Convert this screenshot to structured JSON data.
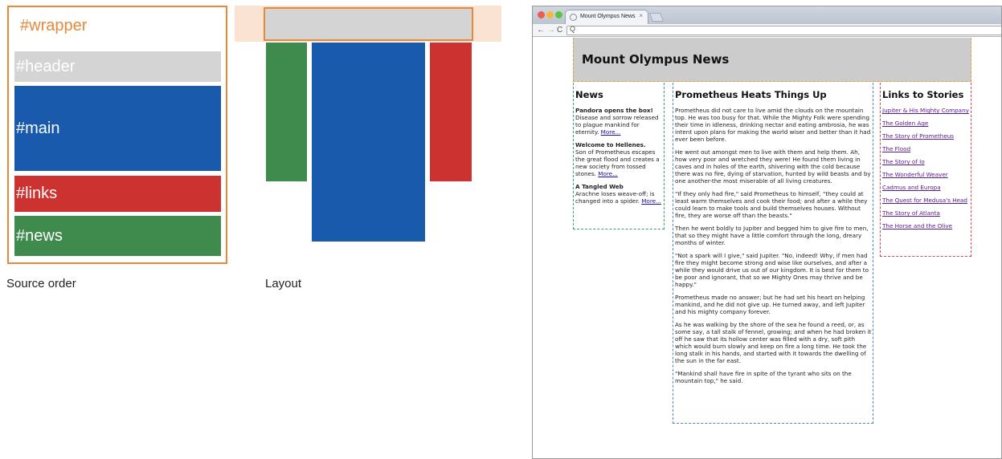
{
  "source_diagram": {
    "wrapper_label": "#wrapper",
    "boxes": [
      {
        "label": "#header",
        "color": "#d4d4d4"
      },
      {
        "label": "#main",
        "color": "#1a5aad"
      },
      {
        "label": "#links",
        "color": "#cc3330"
      },
      {
        "label": "#news",
        "color": "#3f8a4d"
      }
    ],
    "caption": "Source order",
    "accent": "#e8883a"
  },
  "layout_diagram": {
    "caption": "Layout"
  },
  "browser": {
    "tab_title": "Mount Olympus News",
    "tab_close": "×",
    "nav": {
      "back": "←",
      "forward": "→",
      "reload": "C",
      "search": "Q"
    },
    "page": {
      "header_title": "Mount Olympus News",
      "news": {
        "heading": "News",
        "items": [
          {
            "title": "Pandora opens the box!",
            "body": "Disease and sorrow released to plague mankind for eternity.",
            "more": "More..."
          },
          {
            "title": "Welcome to Hellenes.",
            "body": "Son of Prometheus escapes the great flood and creates a new society from tossed stones.",
            "more": "More..."
          },
          {
            "title": "A Tangled Web",
            "body": "Arachne loses weave-off; is changed into a spider.",
            "more": "More..."
          }
        ]
      },
      "main": {
        "heading": "Prometheus Heats Things Up",
        "paragraphs": [
          "Prometheus did not care to live amid the clouds on the mountain top. He was too busy for that. While the Mighty Folk were spending their time in idleness, drinking nectar and eating ambrosia, he was intent upon plans for making the world wiser and better than it had ever been before.",
          "He went out amongst men to live with them and help them. Ah, how very poor and wretched they were! He found them living in caves and in holes of the earth, shivering with the cold because there was no fire, dying of starvation, hunted by wild beasts and by one another-the most miserable of all living creatures.",
          "\"If they only had fire,\" said Prometheus to himself, \"they could at least warm themselves and cook their food; and after a while they could learn to make tools and build themselves houses. Without fire, they are worse off than the beasts.\"",
          "Then he went boldly to Jupiter and begged him to give fire to men, that so they might have a little comfort through the long, dreary months of winter.",
          "\"Not a spark will I give,\" said Jupiter. \"No, indeed! Why, if men had fire they might become strong and wise like ourselves, and after a while they would drive us out of our kingdom. It is best for them to be poor and ignorant, that so we Mighty Ones may thrive and be happy.\"",
          "Prometheus made no answer; but he had set his heart on helping mankind, and he did not give up. He turned away, and left Jupiter and his mighty company forever.",
          "As he was walking by the shore of the sea he found a reed, or, as some say, a tall stalk of fennel, growing; and when he had broken it off he saw that its hollow center was filled with a dry, soft pith which would burn slowly and keep on fire a long time. He took the long stalk in his hands, and started with it towards the dwelling of the sun in the far east.",
          "\"Mankind shall have fire in spite of the tyrant who sits on the mountain top,\" he said."
        ]
      },
      "links": {
        "heading": "Links to Stories",
        "items": [
          "Jupiter & His Mighty Company",
          "The Golden Age",
          "The Story of Prometheus",
          "The Flood",
          "The Story of Io",
          "The Wonderful Weaver",
          "Cadmus and Europa",
          "The Quest for Medusa's Head",
          "The Story of Atlanta",
          "The Horse and the Olive"
        ]
      }
    }
  }
}
